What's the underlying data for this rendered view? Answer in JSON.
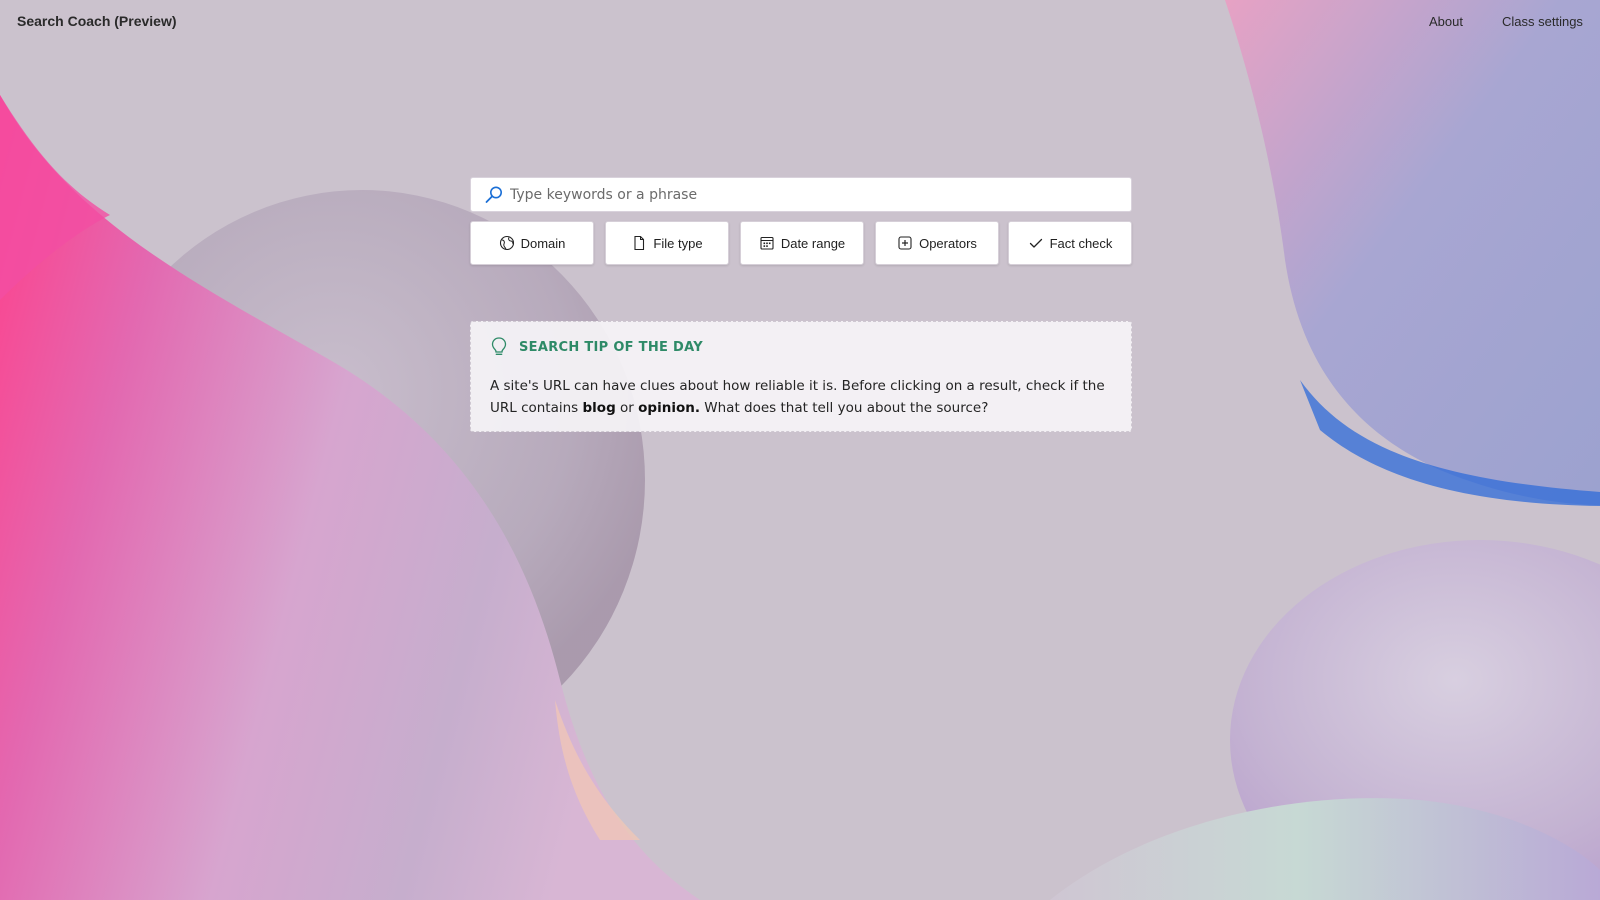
{
  "header": {
    "app_title": "Search Coach (Preview)",
    "nav": [
      {
        "label": "About"
      },
      {
        "label": "Class settings"
      }
    ]
  },
  "search": {
    "placeholder": "Type keywords or a phrase",
    "value": "",
    "icon": "search-icon"
  },
  "filters": [
    {
      "label": "Domain",
      "icon": "globe-icon"
    },
    {
      "label": "File type",
      "icon": "file-icon"
    },
    {
      "label": "Date range",
      "icon": "calendar-icon"
    },
    {
      "label": "Operators",
      "icon": "plus-box-icon"
    },
    {
      "label": "Fact check",
      "icon": "checkmark-icon"
    }
  ],
  "tip": {
    "icon": "lightbulb-icon",
    "title": "SEARCH TIP OF THE DAY",
    "body": {
      "part1": "A site's URL can have clues about how reliable it is. Before clicking on a result, check if the URL contains ",
      "bold1": "blog",
      "part2": " or ",
      "bold2": "opinion.",
      "part3": " What does that tell you about the source?"
    },
    "title_color": "#2e8a67"
  },
  "colors": {
    "background": "#cbc2cd",
    "accent_pink": "#f0409a",
    "accent_blue": "#1b6fd6"
  }
}
